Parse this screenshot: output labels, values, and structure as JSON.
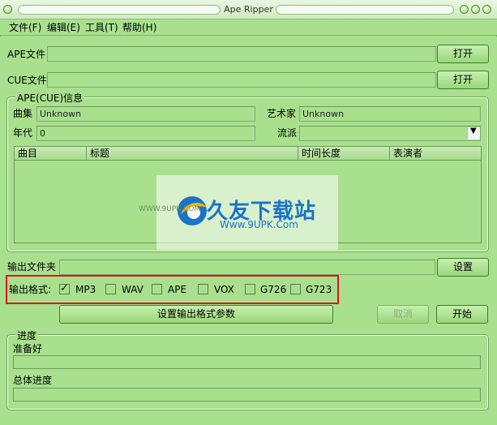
{
  "window": {
    "title": "Ape Ripper"
  },
  "menu": {
    "items": [
      "文件(F)",
      "编辑(E)",
      "工具(T)",
      "帮助(H)"
    ]
  },
  "ape": {
    "label": "APE文件",
    "value": "",
    "button": "打开"
  },
  "cue": {
    "label": "CUE文件",
    "value": "",
    "button": "打开"
  },
  "info_group": {
    "title": "APE(CUE)信息",
    "album_label": "曲集",
    "album_value": "Unknown",
    "artist_label": "艺术家",
    "artist_value": "Unknown",
    "year_label": "年代",
    "year_value": "0",
    "genre_label": "流派",
    "genre_value": "",
    "columns": [
      "曲目",
      "标题",
      "时间长度",
      "表演者"
    ]
  },
  "output": {
    "label": "输出文件夹",
    "value": "",
    "button": "设置"
  },
  "format": {
    "label": "输出格式:",
    "options": [
      {
        "label": "MP3",
        "checked": true
      },
      {
        "label": "WAV",
        "checked": false
      },
      {
        "label": "APE",
        "checked": false
      },
      {
        "label": "VOX",
        "checked": false
      },
      {
        "label": "G726",
        "checked": false
      },
      {
        "label": "G723",
        "checked": false
      }
    ]
  },
  "actions": {
    "params": "设置输出格式参数",
    "cancel": "取消",
    "start": "开始"
  },
  "progress_group": {
    "title": "进度",
    "status": "准备好",
    "overall_label": "总体进度",
    "current_progress": 0,
    "overall_progress": 0
  },
  "watermark": {
    "brand": "久友下载站",
    "url": "Www.9UPK.Com",
    "url_small": "WWW.9UPK.COM"
  },
  "colors": {
    "window_bg": "#a8e08e",
    "highlight_border": "#e0141e",
    "button_border": "#3e7e2c"
  }
}
